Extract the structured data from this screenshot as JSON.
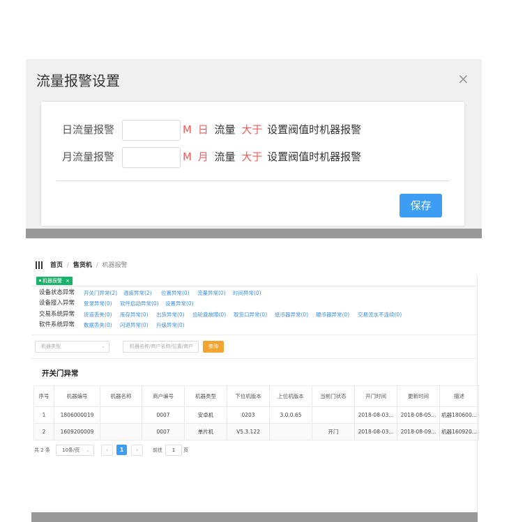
{
  "dialog": {
    "title": "流量报警设置",
    "close_glyph": "×",
    "rows": [
      {
        "label": "日流量报警",
        "unit": "M",
        "period": "日",
        "flow": "流量",
        "cmp": "大于",
        "suffix": "设置阀值时机器报警"
      },
      {
        "label": "月流量报警",
        "unit": "M",
        "period": "月",
        "flow": "流量",
        "cmp": "大于",
        "suffix": "设置阀值时机器报警"
      }
    ],
    "save_label": "保存"
  },
  "app": {
    "breadcrumb": {
      "home": "首页",
      "sep": "/",
      "section": "售货机",
      "current": "机器报警"
    },
    "active_tag": {
      "label": "机器报警",
      "close": "×"
    },
    "categories": [
      {
        "title": "设备状态异常",
        "links": [
          "开关门异常(2)",
          "温度异常(2)",
          "位置异常(0)",
          "流量异常(0)",
          "时间异常(0)"
        ]
      },
      {
        "title": "设备接入异常",
        "links": [
          "登录异常(0)",
          "软件启动异常(0)",
          "设置异常(0)"
        ]
      },
      {
        "title": "交易系统异常",
        "links": [
          "货道丢失(0)",
          "库存异常(0)",
          "出货异常(0)",
          "齿轮盘故障(0)",
          "取货口异常(0)",
          "纸币器异常(0)",
          "硬币器异常(0)",
          "交易流水不连续(0)"
        ]
      },
      {
        "title": "软件系统异常",
        "links": [
          "数据丢失(0)",
          "闪退异常(0)",
          "升级异常(0)"
        ]
      }
    ],
    "filter": {
      "type_placeholder": "机器类型",
      "chevron": "⌄",
      "search_placeholder": "机器名称/商户名称/位置/商户",
      "query_label": "查询"
    },
    "section_title": "开关门异常",
    "table": {
      "headers": [
        "序号",
        "机器编号",
        "机器名称",
        "商户编号",
        "机器类型",
        "下位机版本",
        "上位机版本",
        "当前门状态",
        "开门时间",
        "更新时间",
        "描述"
      ],
      "rows": [
        [
          "1",
          "1806000019",
          "",
          "0007",
          "安卓机",
          "0203",
          "3.0.0.65",
          "",
          "2018-08-03...",
          "2018-08-05...",
          "机器180600..."
        ],
        [
          "2",
          "1609200009",
          "",
          "0007",
          "单片机",
          "V5.3.122",
          "",
          "开门",
          "2018-08-03...",
          "2018-08-09...",
          "机器160920..."
        ]
      ]
    },
    "pagination": {
      "total": "共 2 条",
      "page_size": "10条/页",
      "prev": "‹",
      "current": "1",
      "next": "›",
      "goto_prefix": "前往",
      "goto_value": "1",
      "goto_suffix": "页"
    }
  }
}
